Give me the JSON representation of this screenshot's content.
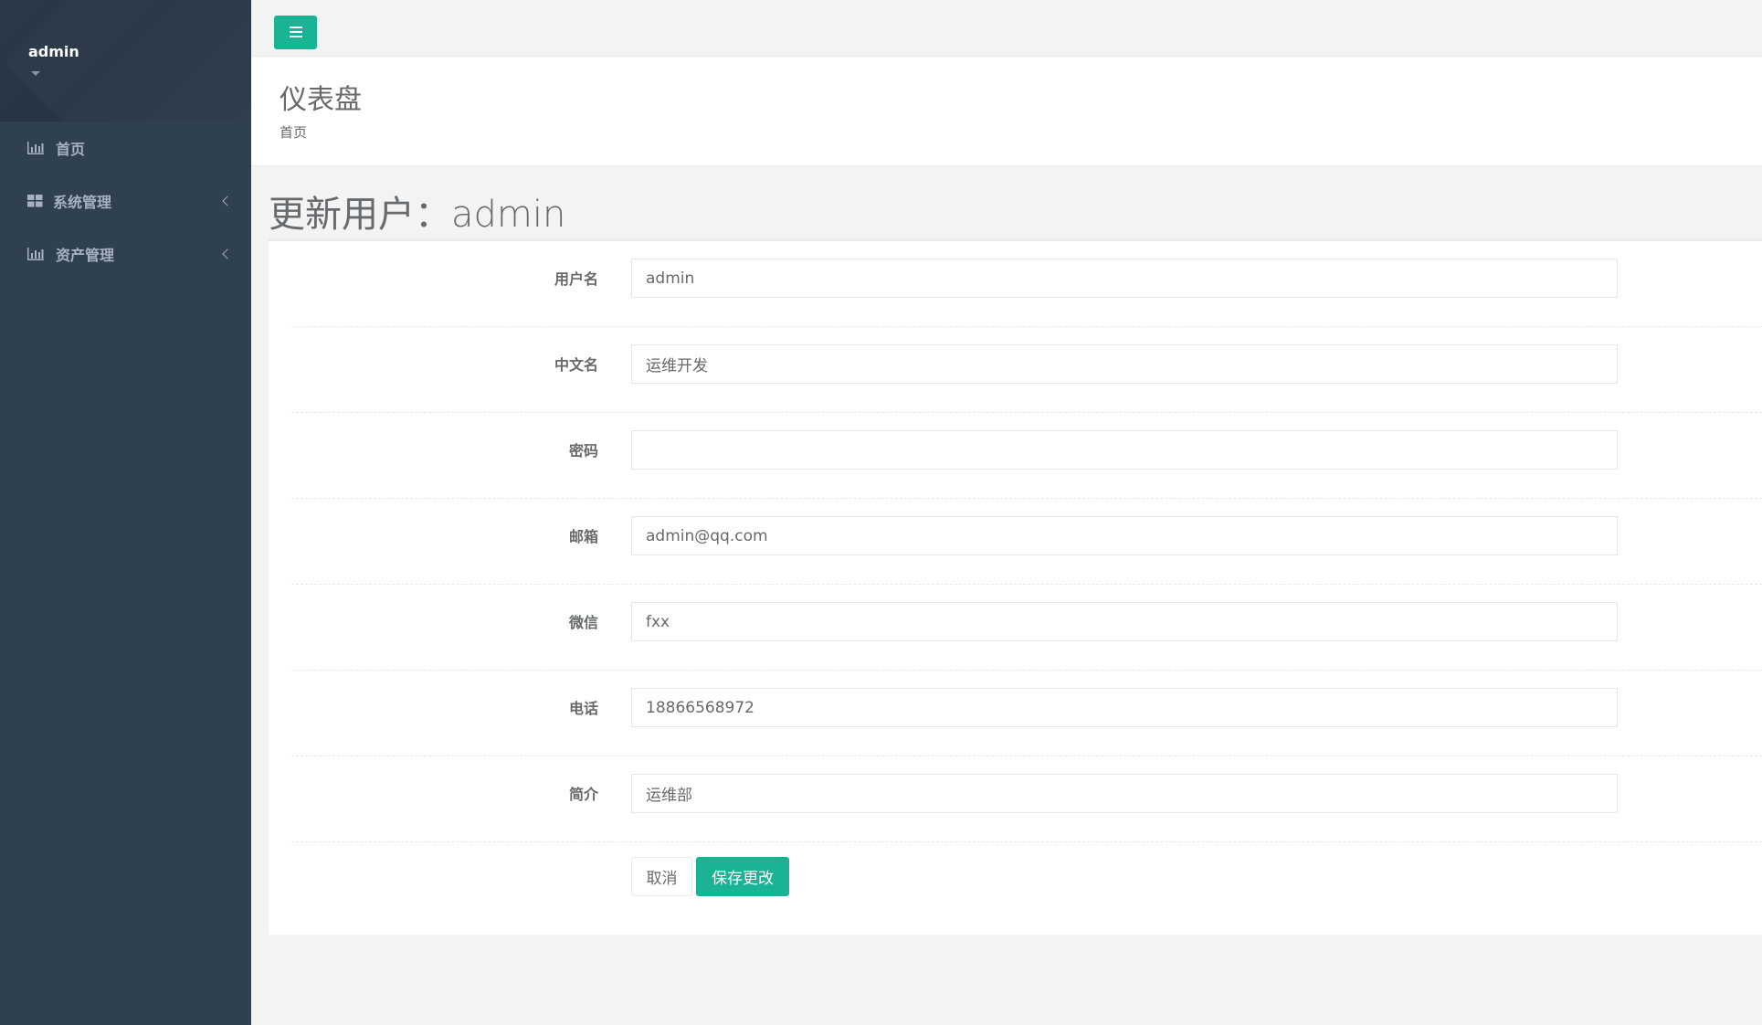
{
  "sidebar": {
    "user": "admin",
    "items": [
      {
        "label": "首页",
        "icon": "bar-chart-icon"
      },
      {
        "label": "系统管理",
        "icon": "grid-icon"
      },
      {
        "label": "资产管理",
        "icon": "bar-chart-icon"
      }
    ]
  },
  "topbar": {
    "menu_icon": "hamburger-icon"
  },
  "heading": {
    "title": "仪表盘",
    "breadcrumb": "首页"
  },
  "form": {
    "title": "更新用户：admin",
    "fields": [
      {
        "label": "用户名",
        "value": "admin"
      },
      {
        "label": "中文名",
        "value": "运维开发"
      },
      {
        "label": "密码",
        "value": ""
      },
      {
        "label": "邮箱",
        "value": "admin@qq.com"
      },
      {
        "label": "微信",
        "value": "fxx"
      },
      {
        "label": "电话",
        "value": "18866568972"
      },
      {
        "label": "简介",
        "value": "运维部"
      }
    ],
    "cancel_label": "取消",
    "save_label": "保存更改"
  },
  "colors": {
    "sidebar_bg": "#2f4050",
    "accent": "#1ab394",
    "page_bg": "#f3f3f4"
  }
}
